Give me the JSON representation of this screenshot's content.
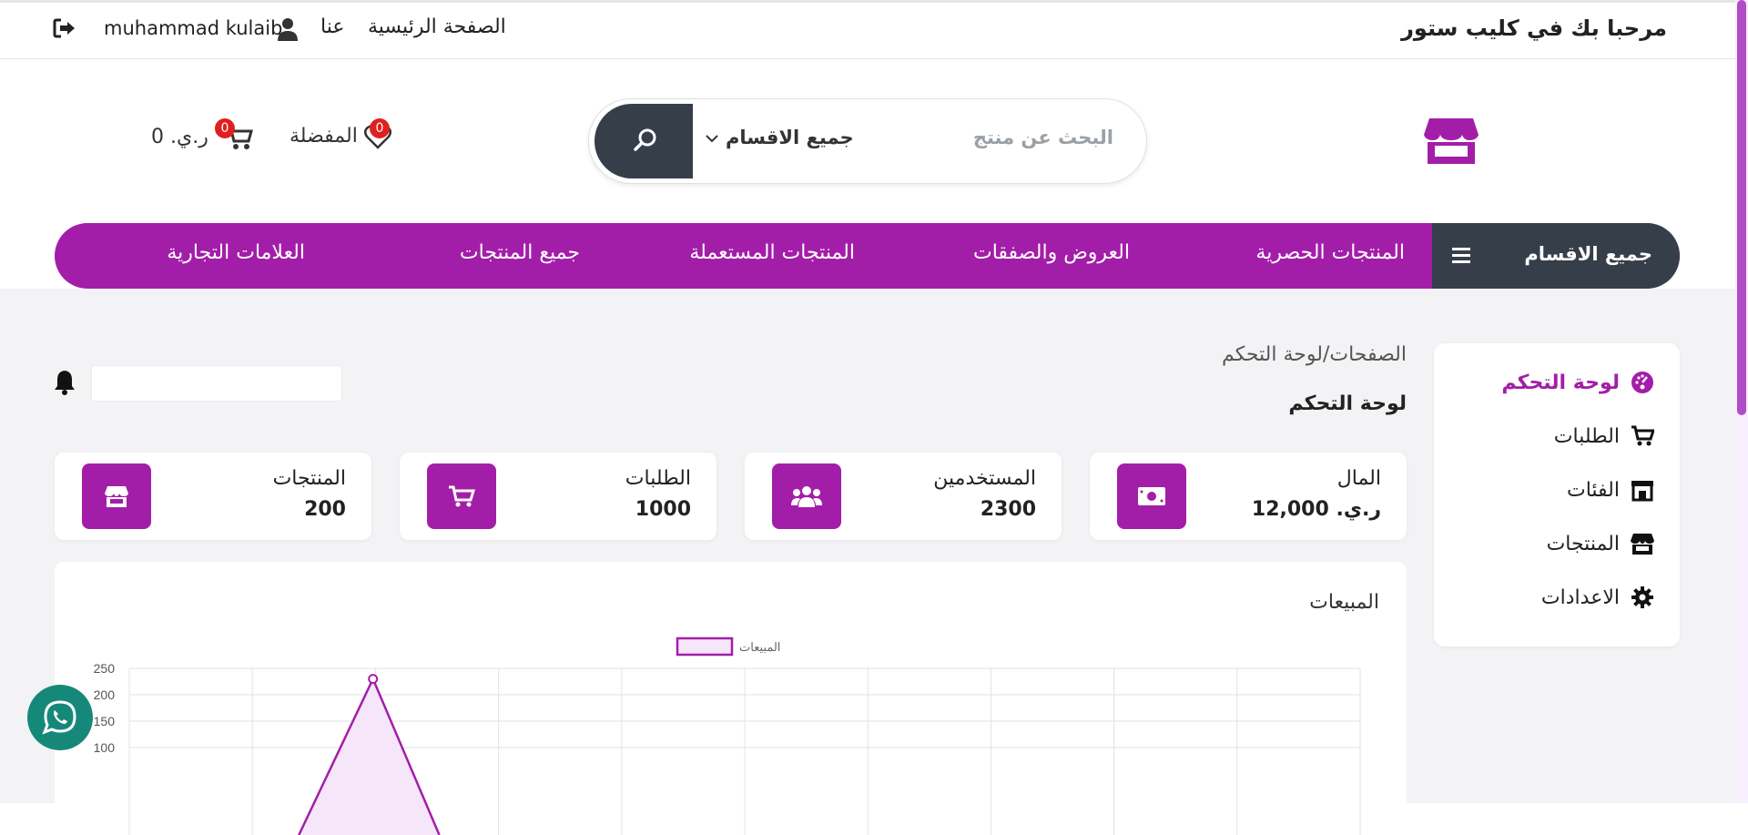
{
  "topbar": {
    "welcome": "مرحبا بك في كليب ستور",
    "home_link": "الصفحة الرئيسية",
    "about_link": "عنا",
    "username": "muhammad kulaib"
  },
  "header": {
    "search_placeholder": "البحث عن منتج",
    "category_select": "جميع الاقسام",
    "favorites_label": "المفضلة",
    "favorites_count": "0",
    "cart_total": "ر.ي. 0",
    "cart_count": "0"
  },
  "nav": {
    "all_categories": "جميع الاقسام",
    "items": [
      "المنتجات الحصرية",
      "العروض والصفقات",
      "المنتجات المستعملة",
      "جميع المنتجات",
      "العلامات التجارية"
    ]
  },
  "sidebar": {
    "items": [
      {
        "label": "لوحة التحكم",
        "icon": "gauge-icon"
      },
      {
        "label": "الطلبات",
        "icon": "cart-icon"
      },
      {
        "label": "الفئات",
        "icon": "category-icon"
      },
      {
        "label": "المنتجات",
        "icon": "store-icon"
      },
      {
        "label": "الاعدادات",
        "icon": "gear-icon"
      }
    ]
  },
  "dashboard": {
    "breadcrumb": "الصفحات/لوحة التحكم",
    "title": "لوحة التحكم",
    "cards": [
      {
        "label": "المال",
        "value": "ر.ي. 12,000",
        "icon": "money-icon"
      },
      {
        "label": "المستخدمين",
        "value": "2300",
        "icon": "users-icon"
      },
      {
        "label": "الطلبات",
        "value": "1000",
        "icon": "cart-icon"
      },
      {
        "label": "المنتجات",
        "value": "200",
        "icon": "store-icon"
      }
    ],
    "chart_title": "المبيعات"
  },
  "colors": {
    "accent": "#a31ea8",
    "dark": "#363e4a",
    "whatsapp": "#16887a"
  },
  "chart_data": {
    "type": "area",
    "title": "",
    "series": [
      {
        "name": "المبيعات",
        "values": [
          null,
          230,
          null
        ]
      }
    ],
    "x_count": 11,
    "ylim": [
      100,
      250
    ],
    "yticks": [
      250,
      200,
      150,
      100
    ],
    "grid": true,
    "legend": "top-center"
  }
}
